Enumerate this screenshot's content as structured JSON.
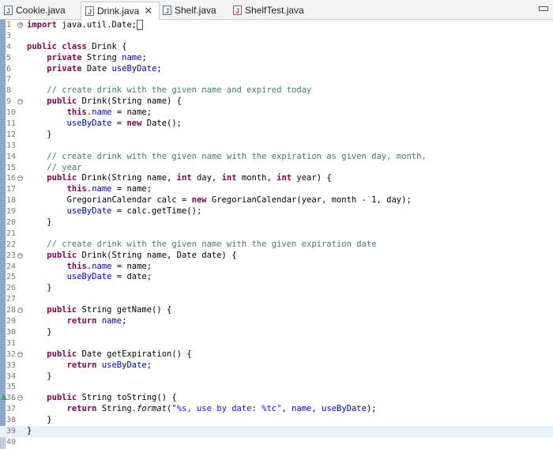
{
  "tabs": [
    {
      "label": "Cookie.java",
      "icon": "java-file-icon",
      "active": false
    },
    {
      "label": "Drink.java",
      "icon": "java-file-icon",
      "active": true
    },
    {
      "label": "Shelf.java",
      "icon": "java-file-icon",
      "active": false
    },
    {
      "label": "ShelfTest.java",
      "icon": "java-test-file-icon",
      "active": false
    }
  ],
  "editor": {
    "lines": [
      {
        "num": "1",
        "text": "import java.util.Date;"
      },
      {
        "num": "3",
        "text": ""
      },
      {
        "num": "4",
        "text": "public class Drink {"
      },
      {
        "num": "5",
        "text": "    private String name;"
      },
      {
        "num": "6",
        "text": "    private Date useByDate;"
      },
      {
        "num": "7",
        "text": ""
      },
      {
        "num": "8",
        "text": "    // create drink with the given name and expired today"
      },
      {
        "num": "9",
        "text": "    public Drink(String name) {"
      },
      {
        "num": "10",
        "text": "        this.name = name;"
      },
      {
        "num": "11",
        "text": "        useByDate = new Date();"
      },
      {
        "num": "12",
        "text": "    }"
      },
      {
        "num": "13",
        "text": ""
      },
      {
        "num": "14",
        "text": "    // create drink with the given name with the expiration as given day, month,"
      },
      {
        "num": "15",
        "text": "    // year"
      },
      {
        "num": "16",
        "text": "    public Drink(String name, int day, int month, int year) {"
      },
      {
        "num": "17",
        "text": "        this.name = name;"
      },
      {
        "num": "18",
        "text": "        GregorianCalendar calc = new GregorianCalendar(year, month - 1, day);"
      },
      {
        "num": "19",
        "text": "        useByDate = calc.getTime();"
      },
      {
        "num": "20",
        "text": "    }"
      },
      {
        "num": "21",
        "text": ""
      },
      {
        "num": "22",
        "text": "    // create drink with the given name with the given expiration date"
      },
      {
        "num": "23",
        "text": "    public Drink(String name, Date date) {"
      },
      {
        "num": "24",
        "text": "        this.name = name;"
      },
      {
        "num": "25",
        "text": "        useByDate = date;"
      },
      {
        "num": "26",
        "text": "    }"
      },
      {
        "num": "27",
        "text": ""
      },
      {
        "num": "28",
        "text": "    public String getName() {"
      },
      {
        "num": "29",
        "text": "        return name;"
      },
      {
        "num": "30",
        "text": "    }"
      },
      {
        "num": "31",
        "text": ""
      },
      {
        "num": "32",
        "text": "    public Date getExpiration() {"
      },
      {
        "num": "33",
        "text": "        return useByDate;"
      },
      {
        "num": "34",
        "text": "    }"
      },
      {
        "num": "35",
        "text": ""
      },
      {
        "num": "36",
        "text": "    public String toString() {"
      },
      {
        "num": "37",
        "text": "        return String.format(\"%s, use by date: %tc\", name, useByDate);"
      },
      {
        "num": "38",
        "text": "    }"
      },
      {
        "num": "39",
        "text": "}"
      },
      {
        "num": "40",
        "text": ""
      }
    ]
  }
}
